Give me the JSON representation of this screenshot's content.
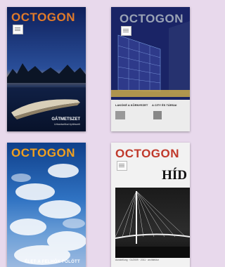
{
  "colors": {
    "background": "#e8d9ec",
    "logo_orange": "#e07a2a",
    "logo_red": "#c0392b"
  },
  "covers": [
    {
      "logo": "OCTOGON",
      "title": "GÁTMETSZET",
      "subtitle": "Urbanisztikai építészeti"
    },
    {
      "logo": "OCTOGON",
      "captions": [
        "LAKÓKÉ A KÖRNYEZET",
        "A CITY ÉS TÁRSAI"
      ]
    },
    {
      "logo": "OCTOGON",
      "title": "ÉLET A FELHŐK FÖLÖTT"
    },
    {
      "logo": "OCTOGON",
      "masthead": "HÍD",
      "footer": "Ausstellung · 01/2009 · 2011 · architektur"
    }
  ]
}
